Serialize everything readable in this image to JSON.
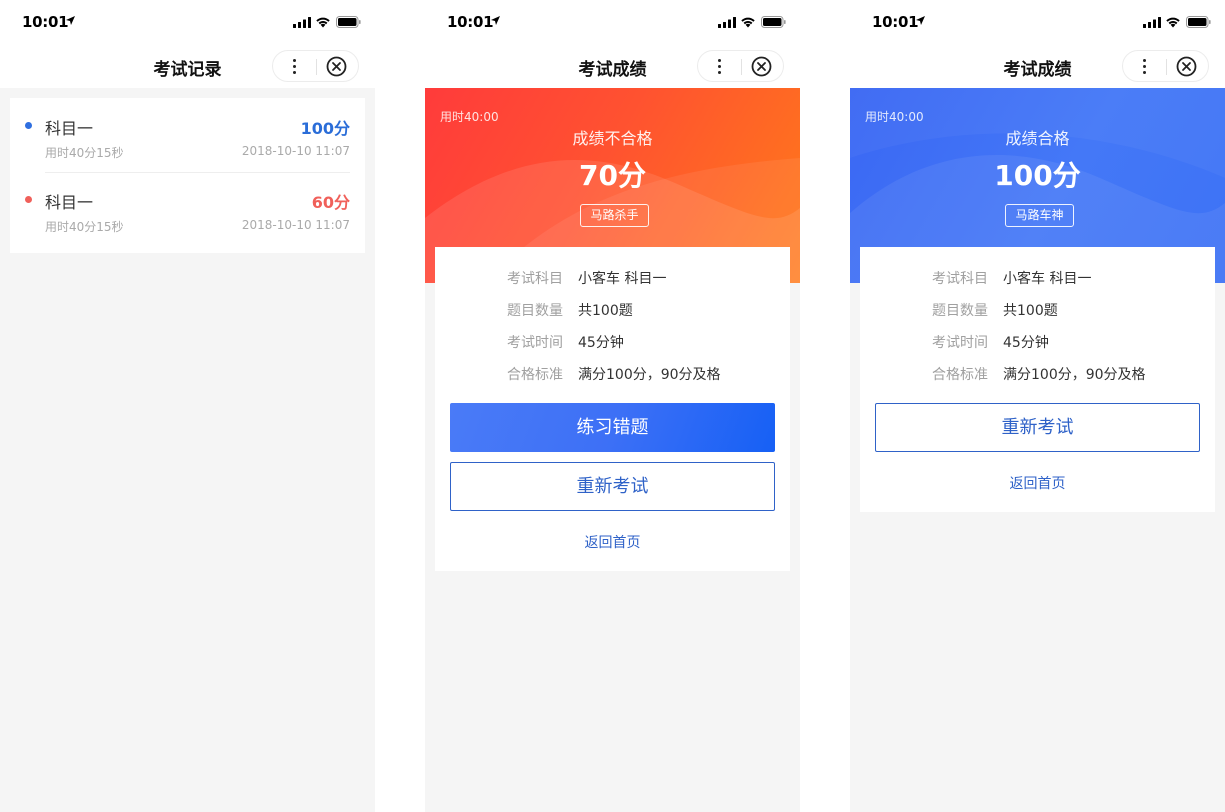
{
  "colors": {
    "accent_blue": "#2f62c8",
    "score_pass": "#2a6dd8",
    "score_fail": "#f0605a",
    "hero_red": "#ff4a2f",
    "hero_blue": "#3f6ff5"
  },
  "status_bar": {
    "time": "10:01",
    "icons": [
      "location-arrow-icon",
      "signal-icon",
      "wifi-icon",
      "battery-icon"
    ]
  },
  "capsule": {
    "icons": [
      "more-icon",
      "close-circle-icon"
    ]
  },
  "records_screen": {
    "title": "考试记录",
    "records": [
      {
        "subject": "科目一",
        "score": "100分",
        "duration": "用时40分15秒",
        "date": "2018-10-10 11:07",
        "dot_color": "#2f6fe0",
        "score_color": "#2a6dd8"
      },
      {
        "subject": "科目一",
        "score": "60分",
        "duration": "用时40分15秒",
        "date": "2018-10-10 11:07",
        "dot_color": "#f0605a",
        "score_color": "#f0605a"
      }
    ]
  },
  "fail_screen": {
    "title": "考试成绩",
    "duration": "用时40:00",
    "status": "成绩不合格",
    "score": "70分",
    "tag": "马路杀手",
    "details": [
      {
        "label": "考试科目",
        "value": "小客车 科目一"
      },
      {
        "label": "题目数量",
        "value": "共100题"
      },
      {
        "label": "考试时间",
        "value": "45分钟"
      },
      {
        "label": "合格标准",
        "value": "满分100分，90分及格"
      }
    ],
    "practice_button": "练习错题",
    "retake_button": "重新考试",
    "home_link": "返回首页"
  },
  "pass_screen": {
    "title": "考试成绩",
    "duration": "用时40:00",
    "status": "成绩合格",
    "score": "100分",
    "tag": "马路车神",
    "details": [
      {
        "label": "考试科目",
        "value": "小客车 科目一"
      },
      {
        "label": "题目数量",
        "value": "共100题"
      },
      {
        "label": "考试时间",
        "value": "45分钟"
      },
      {
        "label": "合格标准",
        "value": "满分100分，90分及格"
      }
    ],
    "retake_button": "重新考试",
    "home_link": "返回首页"
  }
}
